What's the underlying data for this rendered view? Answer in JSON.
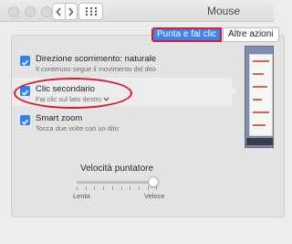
{
  "window": {
    "title": "Mouse"
  },
  "toolbar": {
    "back_icon": "chevron-left-icon",
    "forward_icon": "chevron-right-icon",
    "grid_icon": "grid-icon"
  },
  "tabs": [
    {
      "label": "Punta e fai clic",
      "active": true
    },
    {
      "label": "Altre azioni",
      "active": false
    }
  ],
  "options": [
    {
      "label": "Direzione scorrimento: naturale",
      "description": "Il contenuto segue il movimento del dito",
      "checked": true
    },
    {
      "label": "Clic secondario",
      "description": "Fai clic sul lato destro",
      "checked": true,
      "highlighted": true
    },
    {
      "label": "Smart zoom",
      "description": "Tocca due volte con un dito",
      "checked": true
    }
  ],
  "tracking_speed": {
    "title": "Velocità puntatore",
    "min_label": "Lenta",
    "max_label": "Veloce",
    "value_fraction": 0.95
  },
  "colors": {
    "accent": "#3a84f6",
    "highlight_ring": "#e0182a"
  }
}
